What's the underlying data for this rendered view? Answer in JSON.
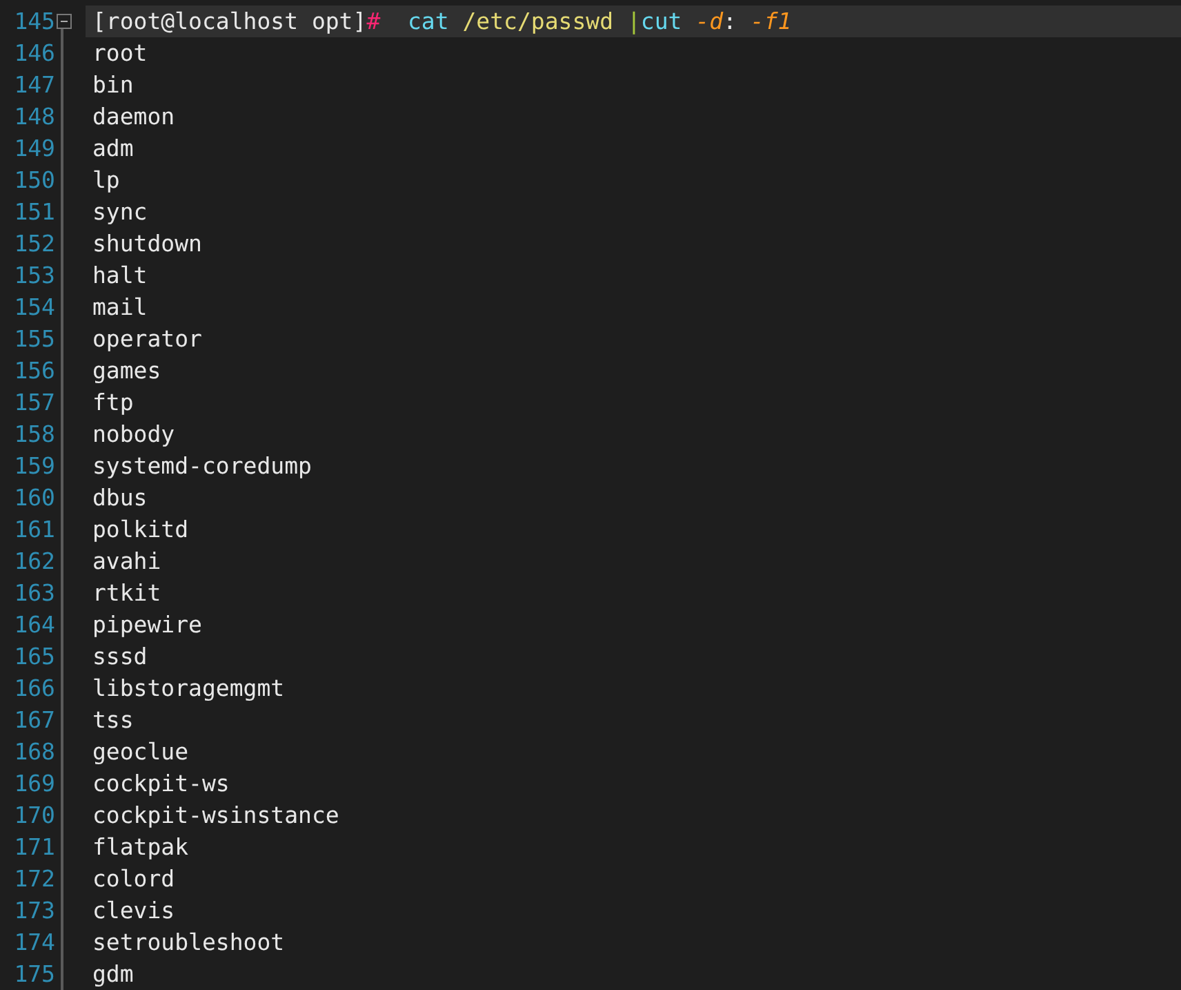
{
  "lines": [
    {
      "number": "145",
      "current": true,
      "expanded": true,
      "segments": [
        {
          "text": "[root@localhost opt]",
          "kind": "prompt"
        },
        {
          "text": "#",
          "kind": "prompt-symbol"
        },
        {
          "text": "  cat",
          "kind": "command"
        },
        {
          "text": " /etc/passwd",
          "kind": "path"
        },
        {
          "text": " |",
          "kind": "pipe"
        },
        {
          "text": "cut",
          "kind": "command"
        },
        {
          "text": " -d",
          "kind": "option"
        },
        {
          "text": ":",
          "kind": "plain"
        },
        {
          "text": " -f1",
          "kind": "option"
        }
      ]
    },
    {
      "number": "146",
      "current": false,
      "segments": [
        {
          "text": "root",
          "kind": "plain"
        }
      ]
    },
    {
      "number": "147",
      "current": false,
      "segments": [
        {
          "text": "bin",
          "kind": "plain"
        }
      ]
    },
    {
      "number": "148",
      "current": false,
      "segments": [
        {
          "text": "daemon",
          "kind": "plain"
        }
      ]
    },
    {
      "number": "149",
      "current": false,
      "segments": [
        {
          "text": "adm",
          "kind": "plain"
        }
      ]
    },
    {
      "number": "150",
      "current": false,
      "segments": [
        {
          "text": "lp",
          "kind": "plain"
        }
      ]
    },
    {
      "number": "151",
      "current": false,
      "segments": [
        {
          "text": "sync",
          "kind": "plain"
        }
      ]
    },
    {
      "number": "152",
      "current": false,
      "segments": [
        {
          "text": "shutdown",
          "kind": "plain"
        }
      ]
    },
    {
      "number": "153",
      "current": false,
      "segments": [
        {
          "text": "halt",
          "kind": "plain"
        }
      ]
    },
    {
      "number": "154",
      "current": false,
      "segments": [
        {
          "text": "mail",
          "kind": "plain"
        }
      ]
    },
    {
      "number": "155",
      "current": false,
      "segments": [
        {
          "text": "operator",
          "kind": "plain"
        }
      ]
    },
    {
      "number": "156",
      "current": false,
      "segments": [
        {
          "text": "games",
          "kind": "plain"
        }
      ]
    },
    {
      "number": "157",
      "current": false,
      "segments": [
        {
          "text": "ftp",
          "kind": "plain"
        }
      ]
    },
    {
      "number": "158",
      "current": false,
      "segments": [
        {
          "text": "nobody",
          "kind": "plain"
        }
      ]
    },
    {
      "number": "159",
      "current": false,
      "segments": [
        {
          "text": "systemd-coredump",
          "kind": "plain"
        }
      ]
    },
    {
      "number": "160",
      "current": false,
      "segments": [
        {
          "text": "dbus",
          "kind": "plain"
        }
      ]
    },
    {
      "number": "161",
      "current": false,
      "segments": [
        {
          "text": "polkitd",
          "kind": "plain"
        }
      ]
    },
    {
      "number": "162",
      "current": false,
      "segments": [
        {
          "text": "avahi",
          "kind": "plain"
        }
      ]
    },
    {
      "number": "163",
      "current": false,
      "segments": [
        {
          "text": "rtkit",
          "kind": "plain"
        }
      ]
    },
    {
      "number": "164",
      "current": false,
      "segments": [
        {
          "text": "pipewire",
          "kind": "plain"
        }
      ]
    },
    {
      "number": "165",
      "current": false,
      "segments": [
        {
          "text": "sssd",
          "kind": "plain"
        }
      ]
    },
    {
      "number": "166",
      "current": false,
      "segments": [
        {
          "text": "libstoragemgmt",
          "kind": "plain"
        }
      ]
    },
    {
      "number": "167",
      "current": false,
      "segments": [
        {
          "text": "tss",
          "kind": "plain"
        }
      ]
    },
    {
      "number": "168",
      "current": false,
      "segments": [
        {
          "text": "geoclue",
          "kind": "plain"
        }
      ]
    },
    {
      "number": "169",
      "current": false,
      "segments": [
        {
          "text": "cockpit-ws",
          "kind": "plain"
        }
      ]
    },
    {
      "number": "170",
      "current": false,
      "segments": [
        {
          "text": "cockpit-wsinstance",
          "kind": "plain"
        }
      ]
    },
    {
      "number": "171",
      "current": false,
      "segments": [
        {
          "text": "flatpak",
          "kind": "plain"
        }
      ]
    },
    {
      "number": "172",
      "current": false,
      "segments": [
        {
          "text": "colord",
          "kind": "plain"
        }
      ]
    },
    {
      "number": "173",
      "current": false,
      "segments": [
        {
          "text": "clevis",
          "kind": "plain"
        }
      ]
    },
    {
      "number": "174",
      "current": false,
      "segments": [
        {
          "text": "setroubleshoot",
          "kind": "plain"
        }
      ]
    },
    {
      "number": "175",
      "current": false,
      "segments": [
        {
          "text": "gdm",
          "kind": "plain"
        }
      ]
    }
  ]
}
